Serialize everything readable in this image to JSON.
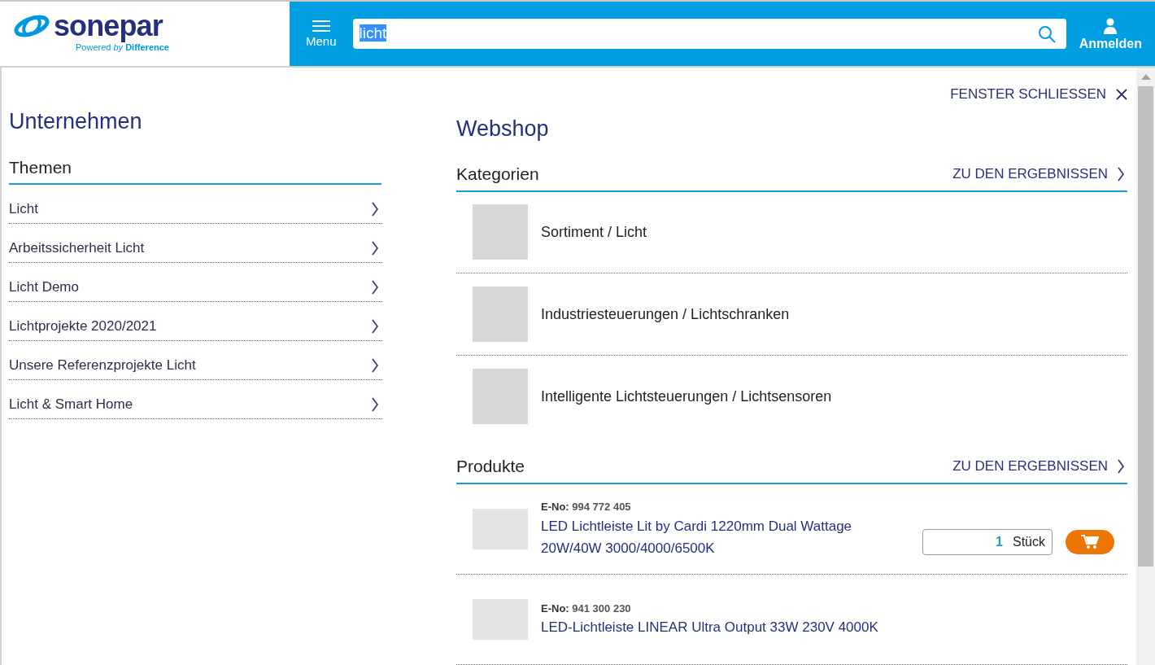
{
  "header": {
    "logo": "sonepar",
    "tagline": "Powered *by* **Difference**",
    "menu": "Menu",
    "search": {
      "value": "licht",
      "text_selected": true
    },
    "login": "Anmelden"
  },
  "close": "FENSTER SCHLIESSEN",
  "company": {
    "title": "Unternehmen",
    "section": "Themen",
    "items": [
      {
        "label": "Licht"
      },
      {
        "label": "Arbeitssicherheit Licht"
      },
      {
        "label": "Licht Demo"
      },
      {
        "label": "Lichtprojekte 2020/2021"
      },
      {
        "label": "Unsere Referenzprojekte Licht"
      },
      {
        "label": "Licht & Smart Home"
      }
    ]
  },
  "webshop": {
    "title": "Webshop",
    "categories": {
      "title": "Kategorien",
      "link": "ZU DEN ERGEBNISSEN",
      "items": [
        {
          "label": "Sortiment / Licht"
        },
        {
          "label": "Industriesteuerungen / Lichtschranken"
        },
        {
          "label": "Intelligente Lichtsteuerungen / Lichtsensoren"
        }
      ]
    },
    "products": {
      "title": "Produkte",
      "link": "ZU DEN ERGEBNISSEN",
      "items": [
        {
          "eno_label": "E-No:",
          "eno": "994 772 405",
          "name": "LED Lichtleiste Lit by Cardi 1220mm Dual Wattage 20W/40W 3000/4000/6500K",
          "quantity": "1",
          "unit": "Stück"
        },
        {
          "eno_label": "E-No:",
          "eno": "941 300 230",
          "name": "LED-Lichtleiste LINEAR Ultra Output 33W 230V 4000K"
        }
      ]
    }
  }
}
